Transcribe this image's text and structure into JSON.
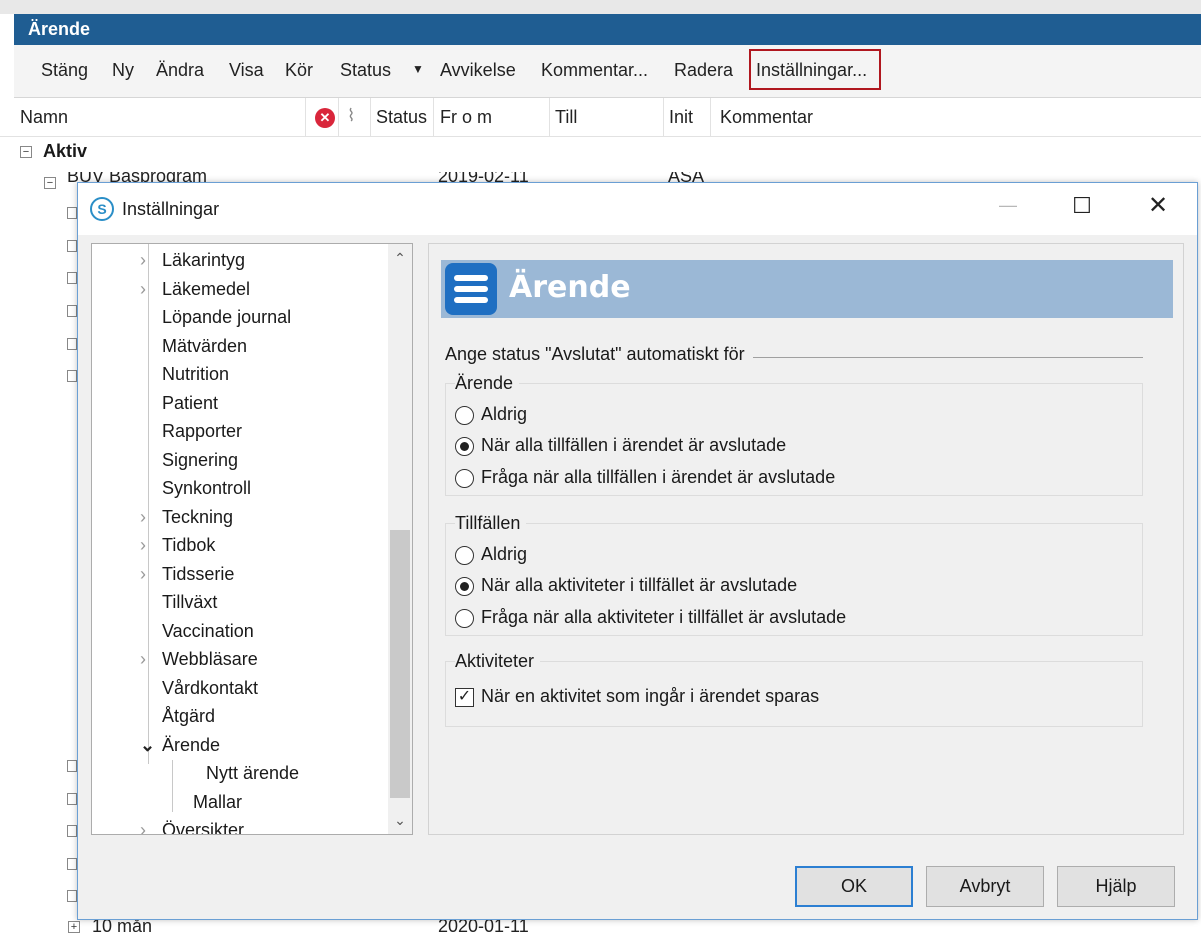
{
  "app": {
    "title": "Ärende",
    "toolbar": {
      "stang": "Stäng",
      "ny": "Ny",
      "andra": "Ändra",
      "visa": "Visa",
      "kor": "Kör",
      "status": "Status",
      "avvikelse": "Avvikelse",
      "kommentar": "Kommentar...",
      "radera": "Radera",
      "installningar": "Inställningar..."
    },
    "columns": {
      "namn": "Namn",
      "status": "Status",
      "from": "Fr o m",
      "till": "Till",
      "init": "Init",
      "kommentar": "Kommentar"
    },
    "group_aktiv": "Aktiv",
    "row_buv": {
      "name": "BUV Basprogram",
      "from": "2019-02-11",
      "init": "ASA"
    },
    "row_last": {
      "name": "10 mån",
      "from": "2020-01-11"
    }
  },
  "dialog": {
    "title": "Inställningar",
    "tree": {
      "items": [
        {
          "label": "Läkarintyg",
          "chevron": "›"
        },
        {
          "label": "Läkemedel",
          "chevron": "›"
        },
        {
          "label": "Löpande journal",
          "chevron": ""
        },
        {
          "label": "Mätvärden",
          "chevron": ""
        },
        {
          "label": "Nutrition",
          "chevron": ""
        },
        {
          "label": "Patient",
          "chevron": ""
        },
        {
          "label": "Rapporter",
          "chevron": ""
        },
        {
          "label": "Signering",
          "chevron": ""
        },
        {
          "label": "Synkontroll",
          "chevron": ""
        },
        {
          "label": "Teckning",
          "chevron": "›"
        },
        {
          "label": "Tidbok",
          "chevron": "›"
        },
        {
          "label": "Tidsserie",
          "chevron": "›"
        },
        {
          "label": "Tillväxt",
          "chevron": ""
        },
        {
          "label": "Vaccination",
          "chevron": ""
        },
        {
          "label": "Webbläsare",
          "chevron": "›"
        },
        {
          "label": "Vårdkontakt",
          "chevron": ""
        },
        {
          "label": "Åtgärd",
          "chevron": ""
        },
        {
          "label": "Ärende",
          "chevron": "⌄"
        },
        {
          "label": "Nytt ärende",
          "chevron": ""
        },
        {
          "label": "Mallar",
          "chevron": ""
        },
        {
          "label": "Översikter",
          "chevron": "›"
        }
      ]
    },
    "panel": {
      "title": "Ärende",
      "section_label": "Ange status \"Avslutat\" automatiskt för",
      "group_arende": {
        "label": "Ärende",
        "opt_never": "Aldrig",
        "opt_auto": "När alla tillfällen i ärendet är avslutade",
        "opt_ask": "Fråga när alla tillfällen i ärendet är avslutade",
        "selected": "auto"
      },
      "group_tillfallen": {
        "label": "Tillfällen",
        "opt_never": "Aldrig",
        "opt_auto": "När alla aktiviteter i tillfället är avslutade",
        "opt_ask": "Fråga när alla aktiviteter i tillfället är avslutade",
        "selected": "auto"
      },
      "group_aktiviteter": {
        "label": "Aktiviteter",
        "checkbox_label": "När en aktivitet som ingår i ärendet sparas",
        "checked": true
      }
    },
    "buttons": {
      "ok": "OK",
      "cancel": "Avbryt",
      "help": "Hjälp"
    },
    "window_controls": {
      "minimize": "—",
      "maximize": "☐",
      "close": "✕"
    }
  },
  "colors": {
    "titlebar": "#1f5d92",
    "highlight_box": "#b0171f",
    "panel_header": "#9bb8d6",
    "accent": "#2c7fd2"
  }
}
